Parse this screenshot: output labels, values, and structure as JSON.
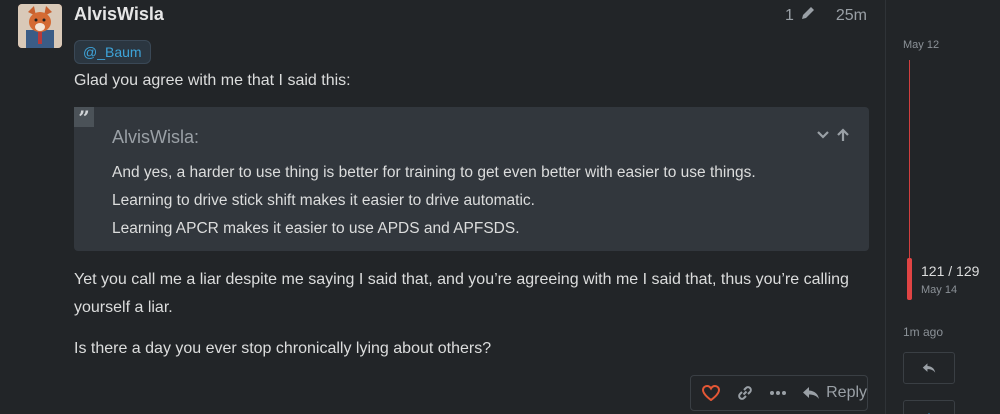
{
  "post": {
    "username": "AlvisWisla",
    "edit_count": "1",
    "age": "25m",
    "mention": "@_Baum",
    "intro": "Glad you agree with me that I said this:",
    "quote": {
      "author": "AlvisWisla:",
      "lines": [
        "And yes, a harder to use thing is better for training to get even better with easier to use things.",
        "Learning to drive stick shift makes it easier to drive automatic.",
        "Learning APCR makes it easier to use APDS and APFSDS."
      ]
    },
    "para2_line1": "Yet you call me a liar despite me saying I said that, and you’re agreeing with me I said that, thus you’re calling",
    "para2_line2": "yourself a liar.",
    "para3": "Is there a day you ever stop chronically lying about others?",
    "actions": {
      "reply_label": "Reply"
    }
  },
  "timeline": {
    "start_date": "May 12",
    "position": "121 / 129",
    "current_date": "May 14",
    "last_activity": "1m ago"
  },
  "colors": {
    "background": "#222528",
    "quote_bg": "#32373d",
    "mention": "#3ea4d9",
    "timeline_accent": "#e04444",
    "like": "#e45735"
  }
}
